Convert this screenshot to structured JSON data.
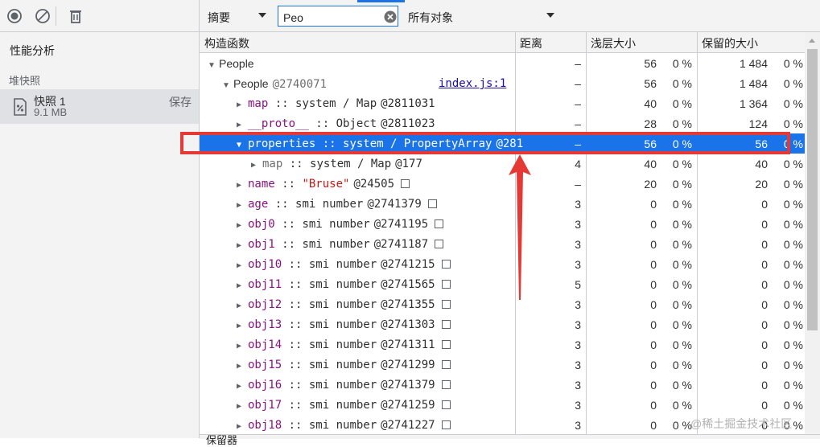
{
  "left": {
    "perf_label": "性能分析",
    "heap_label": "堆快照",
    "snapshot": {
      "name": "快照 1",
      "size": "9.1 MB",
      "save": "保存"
    }
  },
  "toolbar": {
    "view_select": "摘要",
    "filter_value": "Peo",
    "object_select": "所有对象"
  },
  "columns": {
    "constructor": "构造函数",
    "distance": "距离",
    "shallow": "浅层大小",
    "retained": "保留的大小"
  },
  "rows": [
    {
      "indent": 0,
      "arrow": "▼",
      "name": "People",
      "dist": "–",
      "shallow": "56",
      "shallow_pct": "0 %",
      "retained": "1 484",
      "retained_pct": "0 %"
    },
    {
      "indent": 1,
      "arrow": "▼",
      "name": "People",
      "id": "@2740071",
      "link": "index.js:1",
      "dist": "–",
      "shallow": "56",
      "shallow_pct": "0 %",
      "retained": "1 484",
      "retained_pct": "0 %"
    },
    {
      "indent": 2,
      "arrow": "▶",
      "prop": "map",
      "sep": " :: ",
      "type": "system / Map",
      "id": "@2811031",
      "dist": "–",
      "shallow": "40",
      "shallow_pct": "0 %",
      "retained": "1 364",
      "retained_pct": "0 %"
    },
    {
      "indent": 2,
      "arrow": "▶",
      "prop": "__proto__",
      "sep": " :: ",
      "type": "Object",
      "id": "@2811023",
      "dist": "–",
      "shallow": "28",
      "shallow_pct": "0 %",
      "retained": "124",
      "retained_pct": "0 %"
    },
    {
      "indent": 2,
      "arrow": "▼",
      "selected": true,
      "prop": "properties",
      "sep": " :: ",
      "type": "system / PropertyArray",
      "id": "@281",
      "dist": "–",
      "shallow": "56",
      "shallow_pct": "0 %",
      "retained": "56",
      "retained_pct": "0 %"
    },
    {
      "indent": 3,
      "arrow": "▶",
      "dim": true,
      "prop": "map",
      "sep": " :: ",
      "type": "system / Map",
      "id": "@177",
      "dist": "4",
      "shallow": "40",
      "shallow_pct": "0 %",
      "retained": "40",
      "retained_pct": "0 %"
    },
    {
      "indent": 2,
      "arrow": "▶",
      "prop": "name",
      "sep": " :: ",
      "str": "\"Bruse\"",
      "id": "@24505",
      "box": true,
      "dist": "–",
      "shallow": "20",
      "shallow_pct": "0 %",
      "retained": "20",
      "retained_pct": "0 %"
    },
    {
      "indent": 2,
      "arrow": "▶",
      "prop": "age",
      "sep": " :: ",
      "type": "smi number",
      "id": "@2741379",
      "box": true,
      "dist": "3",
      "shallow": "0",
      "shallow_pct": "0 %",
      "retained": "0",
      "retained_pct": "0 %"
    },
    {
      "indent": 2,
      "arrow": "▶",
      "prop": "obj0",
      "sep": " :: ",
      "type": "smi number",
      "id": "@2741195",
      "box": true,
      "dist": "3",
      "shallow": "0",
      "shallow_pct": "0 %",
      "retained": "0",
      "retained_pct": "0 %"
    },
    {
      "indent": 2,
      "arrow": "▶",
      "prop": "obj1",
      "sep": " :: ",
      "type": "smi number",
      "id": "@2741187",
      "box": true,
      "dist": "3",
      "shallow": "0",
      "shallow_pct": "0 %",
      "retained": "0",
      "retained_pct": "0 %"
    },
    {
      "indent": 2,
      "arrow": "▶",
      "prop": "obj10",
      "sep": " :: ",
      "type": "smi number",
      "id": "@2741215",
      "box": true,
      "dist": "3",
      "shallow": "0",
      "shallow_pct": "0 %",
      "retained": "0",
      "retained_pct": "0 %"
    },
    {
      "indent": 2,
      "arrow": "▶",
      "prop": "obj11",
      "sep": " :: ",
      "type": "smi number",
      "id": "@2741565",
      "box": true,
      "dist": "5",
      "shallow": "0",
      "shallow_pct": "0 %",
      "retained": "0",
      "retained_pct": "0 %"
    },
    {
      "indent": 2,
      "arrow": "▶",
      "prop": "obj12",
      "sep": " :: ",
      "type": "smi number",
      "id": "@2741355",
      "box": true,
      "dist": "3",
      "shallow": "0",
      "shallow_pct": "0 %",
      "retained": "0",
      "retained_pct": "0 %"
    },
    {
      "indent": 2,
      "arrow": "▶",
      "prop": "obj13",
      "sep": " :: ",
      "type": "smi number",
      "id": "@2741303",
      "box": true,
      "dist": "3",
      "shallow": "0",
      "shallow_pct": "0 %",
      "retained": "0",
      "retained_pct": "0 %"
    },
    {
      "indent": 2,
      "arrow": "▶",
      "prop": "obj14",
      "sep": " :: ",
      "type": "smi number",
      "id": "@2741311",
      "box": true,
      "dist": "3",
      "shallow": "0",
      "shallow_pct": "0 %",
      "retained": "0",
      "retained_pct": "0 %"
    },
    {
      "indent": 2,
      "arrow": "▶",
      "prop": "obj15",
      "sep": " :: ",
      "type": "smi number",
      "id": "@2741299",
      "box": true,
      "dist": "3",
      "shallow": "0",
      "shallow_pct": "0 %",
      "retained": "0",
      "retained_pct": "0 %"
    },
    {
      "indent": 2,
      "arrow": "▶",
      "prop": "obj16",
      "sep": " :: ",
      "type": "smi number",
      "id": "@2741379",
      "box": true,
      "dist": "3",
      "shallow": "0",
      "shallow_pct": "0 %",
      "retained": "0",
      "retained_pct": "0 %"
    },
    {
      "indent": 2,
      "arrow": "▶",
      "prop": "obj17",
      "sep": " :: ",
      "type": "smi number",
      "id": "@2741259",
      "box": true,
      "dist": "3",
      "shallow": "0",
      "shallow_pct": "0 %",
      "retained": "0",
      "retained_pct": "0 %"
    },
    {
      "indent": 2,
      "arrow": "▶",
      "prop": "obj18",
      "sep": " :: ",
      "type": "smi number",
      "id": "@2741227",
      "box": true,
      "dist": "3",
      "shallow": "0",
      "shallow_pct": "0 %",
      "retained": "0",
      "retained_pct": "0 %"
    }
  ],
  "bottom_label": "保留器",
  "watermark": "@稀土掘金技术社区",
  "colors": {
    "accent": "#1a73e8",
    "annotation": "#e53935",
    "property": "#881280",
    "string": "#c41a16"
  }
}
